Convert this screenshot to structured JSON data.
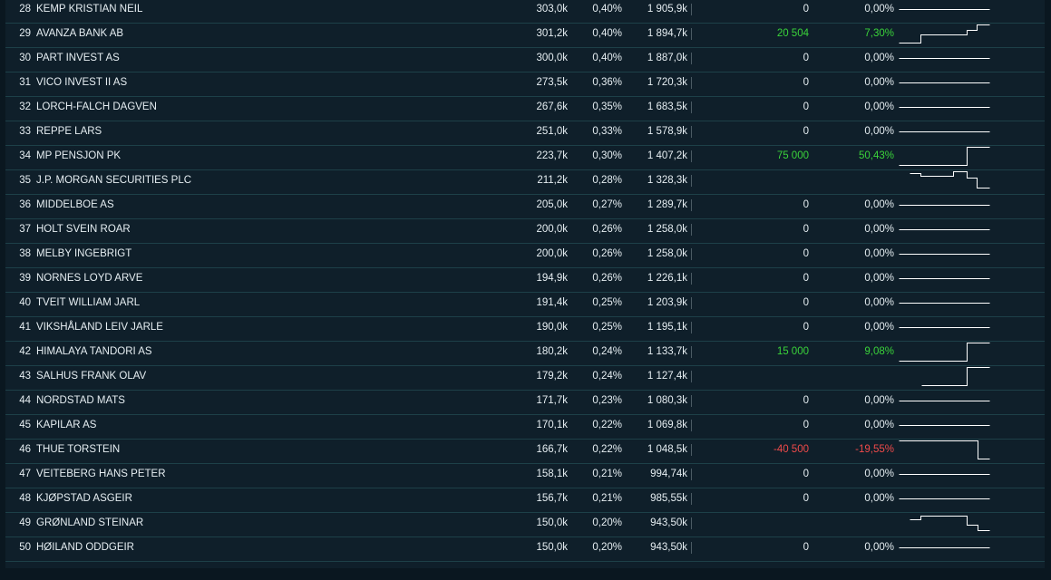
{
  "rows": [
    {
      "rank": "28",
      "name": "KEMP KRISTIAN NEIL",
      "shares": "303,0k",
      "pct": "0,40%",
      "value": "1 905,9k",
      "change": "0",
      "change_pct": "0,00%",
      "trend": "flat",
      "spark": [
        [
          0,
          0.5
        ],
        [
          1,
          0.5
        ]
      ]
    },
    {
      "rank": "29",
      "name": "AVANZA BANK AB",
      "shares": "301,2k",
      "pct": "0,40%",
      "value": "1 894,7k",
      "change": "20 504",
      "change_pct": "7,30%",
      "trend": "up",
      "spark": [
        [
          0,
          1
        ],
        [
          0.24,
          1
        ],
        [
          0.24,
          0.55
        ],
        [
          0.75,
          0.55
        ],
        [
          0.75,
          0.3
        ],
        [
          0.86,
          0.3
        ],
        [
          0.86,
          0
        ],
        [
          1,
          0
        ]
      ]
    },
    {
      "rank": "30",
      "name": "PART INVEST AS",
      "shares": "300,0k",
      "pct": "0,40%",
      "value": "1 887,0k",
      "change": "0",
      "change_pct": "0,00%",
      "trend": "flat",
      "spark": [
        [
          0,
          0.5
        ],
        [
          1,
          0.5
        ]
      ]
    },
    {
      "rank": "31",
      "name": "VICO INVEST II AS",
      "shares": "273,5k",
      "pct": "0,36%",
      "value": "1 720,3k",
      "change": "0",
      "change_pct": "0,00%",
      "trend": "flat",
      "spark": [
        [
          0,
          0.5
        ],
        [
          1,
          0.5
        ]
      ]
    },
    {
      "rank": "32",
      "name": "LORCH-FALCH DAGVEN",
      "shares": "267,6k",
      "pct": "0,35%",
      "value": "1 683,5k",
      "change": "0",
      "change_pct": "0,00%",
      "trend": "flat",
      "spark": [
        [
          0,
          0.5
        ],
        [
          1,
          0.5
        ]
      ]
    },
    {
      "rank": "33",
      "name": "REPPE LARS",
      "shares": "251,0k",
      "pct": "0,33%",
      "value": "1 578,9k",
      "change": "0",
      "change_pct": "0,00%",
      "trend": "flat",
      "spark": [
        [
          0,
          0.5
        ],
        [
          1,
          0.5
        ]
      ]
    },
    {
      "rank": "34",
      "name": "MP PENSJON PK",
      "shares": "223,7k",
      "pct": "0,30%",
      "value": "1 407,2k",
      "change": "75 000",
      "change_pct": "50,43%",
      "trend": "up",
      "spark": [
        [
          0,
          1
        ],
        [
          0.75,
          1
        ],
        [
          0.75,
          0
        ],
        [
          1,
          0
        ]
      ]
    },
    {
      "rank": "35",
      "name": "J.P. MORGAN SECURITIES PLC",
      "shares": "211,2k",
      "pct": "0,28%",
      "value": "1 328,3k",
      "change": "",
      "change_pct": "",
      "trend": "flat",
      "spark": [
        [
          0.12,
          0.1
        ],
        [
          0.24,
          0.1
        ],
        [
          0.24,
          0.25
        ],
        [
          0.6,
          0.25
        ],
        [
          0.6,
          0
        ],
        [
          0.75,
          0
        ],
        [
          0.75,
          0.35
        ],
        [
          0.86,
          0.35
        ],
        [
          0.86,
          0.9
        ],
        [
          1,
          0.9
        ]
      ]
    },
    {
      "rank": "36",
      "name": "MIDDELBOE AS",
      "shares": "205,0k",
      "pct": "0,27%",
      "value": "1 289,7k",
      "change": "0",
      "change_pct": "0,00%",
      "trend": "flat",
      "spark": [
        [
          0,
          0.5
        ],
        [
          1,
          0.5
        ]
      ]
    },
    {
      "rank": "37",
      "name": "HOLT SVEIN ROAR",
      "shares": "200,0k",
      "pct": "0,26%",
      "value": "1 258,0k",
      "change": "0",
      "change_pct": "0,00%",
      "trend": "flat",
      "spark": [
        [
          0,
          0.5
        ],
        [
          1,
          0.5
        ]
      ]
    },
    {
      "rank": "38",
      "name": "MELBY INGEBRIGT",
      "shares": "200,0k",
      "pct": "0,26%",
      "value": "1 258,0k",
      "change": "0",
      "change_pct": "0,00%",
      "trend": "flat",
      "spark": [
        [
          0,
          0.5
        ],
        [
          1,
          0.5
        ]
      ]
    },
    {
      "rank": "39",
      "name": "NORNES LOYD ARVE",
      "shares": "194,9k",
      "pct": "0,26%",
      "value": "1 226,1k",
      "change": "0",
      "change_pct": "0,00%",
      "trend": "flat",
      "spark": [
        [
          0,
          0.5
        ],
        [
          1,
          0.5
        ]
      ]
    },
    {
      "rank": "40",
      "name": "TVEIT WILLIAM JARL",
      "shares": "191,4k",
      "pct": "0,25%",
      "value": "1 203,9k",
      "change": "0",
      "change_pct": "0,00%",
      "trend": "flat",
      "spark": [
        [
          0,
          0.5
        ],
        [
          1,
          0.5
        ]
      ]
    },
    {
      "rank": "41",
      "name": "VIKSHÅLAND LEIV JARLE",
      "shares": "190,0k",
      "pct": "0,25%",
      "value": "1 195,1k",
      "change": "0",
      "change_pct": "0,00%",
      "trend": "flat",
      "spark": [
        [
          0,
          0.5
        ],
        [
          1,
          0.5
        ]
      ]
    },
    {
      "rank": "42",
      "name": "HIMALAYA TANDORI AS",
      "shares": "180,2k",
      "pct": "0,24%",
      "value": "1 133,7k",
      "change": "15 000",
      "change_pct": "9,08%",
      "trend": "up",
      "spark": [
        [
          0,
          1
        ],
        [
          0.75,
          1
        ],
        [
          0.75,
          0
        ],
        [
          1,
          0
        ]
      ]
    },
    {
      "rank": "43",
      "name": "SALHUS FRANK OLAV",
      "shares": "179,2k",
      "pct": "0,24%",
      "value": "1 127,4k",
      "change": "",
      "change_pct": "",
      "trend": "flat",
      "spark": [
        [
          0.25,
          1
        ],
        [
          0.75,
          1
        ],
        [
          0.75,
          0
        ],
        [
          1,
          0
        ]
      ]
    },
    {
      "rank": "44",
      "name": "NORDSTAD MATS",
      "shares": "171,7k",
      "pct": "0,23%",
      "value": "1 080,3k",
      "change": "0",
      "change_pct": "0,00%",
      "trend": "flat",
      "spark": [
        [
          0,
          0.5
        ],
        [
          1,
          0.5
        ]
      ]
    },
    {
      "rank": "45",
      "name": "KAPILAR AS",
      "shares": "170,1k",
      "pct": "0,22%",
      "value": "1 069,8k",
      "change": "0",
      "change_pct": "0,00%",
      "trend": "flat",
      "spark": [
        [
          0,
          0.5
        ],
        [
          1,
          0.5
        ]
      ]
    },
    {
      "rank": "46",
      "name": "THUE TORSTEIN",
      "shares": "166,7k",
      "pct": "0,22%",
      "value": "1 048,5k",
      "change": "-40 500",
      "change_pct": "-19,55%",
      "trend": "down",
      "spark": [
        [
          0,
          0
        ],
        [
          0.87,
          0
        ],
        [
          0.87,
          1
        ],
        [
          1,
          1
        ]
      ]
    },
    {
      "rank": "47",
      "name": "VEITEBERG HANS PETER",
      "shares": "158,1k",
      "pct": "0,21%",
      "value": "994,74k",
      "change": "0",
      "change_pct": "0,00%",
      "trend": "flat",
      "spark": [
        [
          0,
          0.5
        ],
        [
          1,
          0.5
        ]
      ]
    },
    {
      "rank": "48",
      "name": "KJØPSTAD ASGEIR",
      "shares": "156,7k",
      "pct": "0,21%",
      "value": "985,55k",
      "change": "0",
      "change_pct": "0,00%",
      "trend": "flat",
      "spark": [
        [
          0,
          0.5
        ],
        [
          1,
          0.5
        ]
      ]
    },
    {
      "rank": "49",
      "name": "GRØNLAND STEINAR",
      "shares": "150,0k",
      "pct": "0,20%",
      "value": "943,50k",
      "change": "",
      "change_pct": "",
      "trend": "flat",
      "spark": [
        [
          0.12,
          0.3
        ],
        [
          0.24,
          0.3
        ],
        [
          0.24,
          0.1
        ],
        [
          0.6,
          0.1
        ],
        [
          0.6,
          0.1
        ],
        [
          0.75,
          0.1
        ],
        [
          0.75,
          0.6
        ],
        [
          0.87,
          0.6
        ],
        [
          0.87,
          0.9
        ],
        [
          1,
          0.9
        ]
      ]
    },
    {
      "rank": "50",
      "name": "HØILAND ODDGEIR",
      "shares": "150,0k",
      "pct": "0,20%",
      "value": "943,50k",
      "change": "0",
      "change_pct": "0,00%",
      "trend": "flat",
      "spark": [
        [
          0,
          0.5
        ],
        [
          1,
          0.5
        ]
      ]
    }
  ],
  "colors": {
    "positive": "#3ad33a",
    "negative": "#f04a4a",
    "text": "#e6eef2",
    "row_border": "#1d4048",
    "background": "#0f1f2a"
  }
}
